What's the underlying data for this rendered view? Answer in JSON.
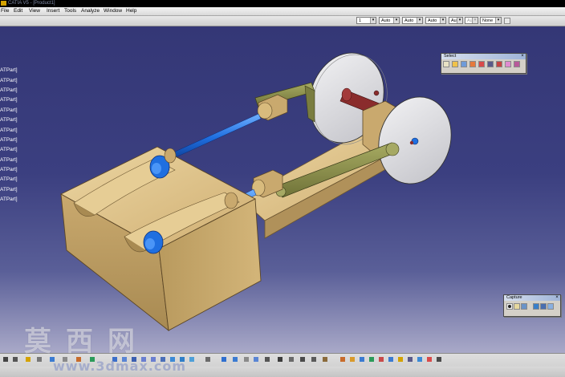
{
  "window": {
    "title": "CATIA V5 - [Product1]"
  },
  "menu": [
    {
      "label": "File"
    },
    {
      "label": "Edit"
    },
    {
      "label": "View"
    },
    {
      "label": "Insert"
    },
    {
      "label": "Tools"
    },
    {
      "label": "Analyze"
    },
    {
      "label": "Window"
    },
    {
      "label": "Help"
    }
  ],
  "toolbar": {
    "layer": "1",
    "dropdowns": [
      {
        "value": "Auto"
      },
      {
        "value": "Auto"
      },
      {
        "value": "Auto"
      },
      {
        "value": "Aut"
      },
      {
        "value": "Aut"
      },
      {
        "value": "None"
      }
    ]
  },
  "tree": {
    "items": [
      "ATPart]",
      "ATPart]",
      "ATPart]",
      "ATPart]",
      "ATPart]",
      "ATPart]",
      "ATPart]",
      "ATPart]",
      "ATPart]",
      "ATPart]",
      "ATPart]",
      "ATPart]",
      "ATPart]",
      "ATPart]"
    ]
  },
  "select_panel": {
    "title": "Select"
  },
  "capture_panel": {
    "title": "Capture"
  },
  "watermark": {
    "text": "莫西网",
    "sub": "www.3dmax.com"
  },
  "colors": {
    "body": "#c9a96e",
    "rod_blue": "#1f6fe0",
    "linkage_green": "#8c8f4a",
    "wheel": "#d9d9dd",
    "viewport_top": "#343776",
    "viewport_bottom": "#a9a9c8"
  }
}
